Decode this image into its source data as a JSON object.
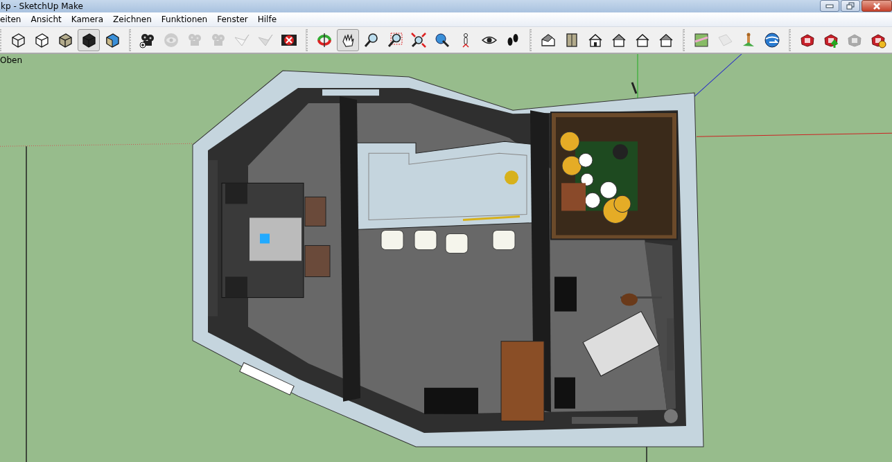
{
  "window": {
    "title": "kp - SketchUp Make"
  },
  "menu": [
    "eiten",
    "Ansicht",
    "Kamera",
    "Zeichnen",
    "Funktionen",
    "Fenster",
    "Hilfe"
  ],
  "toolbar_groups": [
    {
      "tools": [
        {
          "kind": "wireframe",
          "selected": false,
          "disabled": false
        },
        {
          "kind": "hidden-line",
          "selected": false,
          "disabled": false
        },
        {
          "kind": "shaded",
          "selected": false,
          "disabled": false
        },
        {
          "kind": "textured",
          "selected": true,
          "disabled": false
        },
        {
          "kind": "xray",
          "selected": false,
          "disabled": false
        }
      ]
    },
    {
      "tools": [
        {
          "kind": "add-scene",
          "selected": false,
          "disabled": false
        },
        {
          "kind": "eye-disc",
          "selected": false,
          "disabled": true
        },
        {
          "kind": "reel",
          "selected": false,
          "disabled": true
        },
        {
          "kind": "reel",
          "selected": false,
          "disabled": true
        },
        {
          "kind": "section-plane",
          "selected": false,
          "disabled": true
        },
        {
          "kind": "section-cut",
          "selected": false,
          "disabled": true
        },
        {
          "kind": "red-x",
          "selected": false,
          "disabled": false
        }
      ]
    },
    {
      "tools": [
        {
          "kind": "orbit",
          "selected": false,
          "disabled": false
        },
        {
          "kind": "pan",
          "selected": true,
          "disabled": false
        },
        {
          "kind": "zoom",
          "selected": false,
          "disabled": false
        },
        {
          "kind": "zoom-window",
          "selected": false,
          "disabled": false
        },
        {
          "kind": "zoom-extents",
          "selected": false,
          "disabled": false
        },
        {
          "kind": "previous",
          "selected": false,
          "disabled": false
        },
        {
          "kind": "person",
          "selected": false,
          "disabled": false
        },
        {
          "kind": "look-around",
          "selected": false,
          "disabled": false
        },
        {
          "kind": "walk",
          "selected": false,
          "disabled": false
        }
      ]
    },
    {
      "tools": [
        {
          "kind": "house-iso",
          "selected": false,
          "disabled": false
        },
        {
          "kind": "box",
          "selected": false,
          "disabled": false
        },
        {
          "kind": "house-front",
          "selected": false,
          "disabled": false
        },
        {
          "kind": "house-side",
          "selected": false,
          "disabled": false
        },
        {
          "kind": "house-outline",
          "selected": false,
          "disabled": false
        },
        {
          "kind": "house-side",
          "selected": false,
          "disabled": false
        }
      ]
    },
    {
      "tools": [
        {
          "kind": "map",
          "selected": false,
          "disabled": false
        },
        {
          "kind": "paper",
          "selected": false,
          "disabled": true
        },
        {
          "kind": "placemark",
          "selected": false,
          "disabled": false
        },
        {
          "kind": "globe",
          "selected": false,
          "disabled": false
        }
      ]
    },
    {
      "tools": [
        {
          "kind": "warehouse",
          "selected": false,
          "disabled": false
        },
        {
          "kind": "warehouse-upload",
          "selected": false,
          "disabled": false
        },
        {
          "kind": "warehouse",
          "selected": false,
          "disabled": true
        },
        {
          "kind": "warehouse-sync",
          "selected": false,
          "disabled": false
        }
      ]
    }
  ],
  "viewport": {
    "view_label": "Oben"
  }
}
